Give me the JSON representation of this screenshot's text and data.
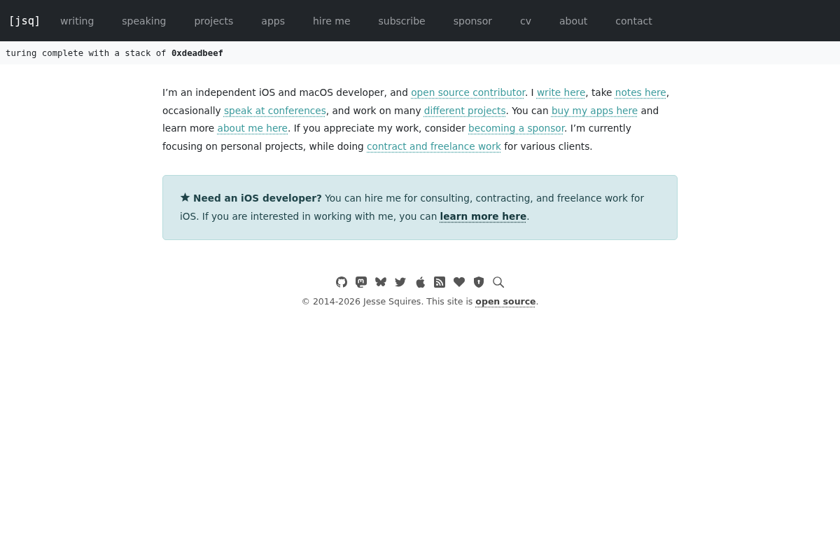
{
  "header": {
    "logo": "[jsq]",
    "nav": [
      {
        "label": "writing"
      },
      {
        "label": "speaking"
      },
      {
        "label": "projects"
      },
      {
        "label": "apps"
      },
      {
        "label": "hire me"
      },
      {
        "label": "subscribe"
      },
      {
        "label": "sponsor"
      },
      {
        "label": "cv"
      },
      {
        "label": "about"
      },
      {
        "label": "contact"
      }
    ]
  },
  "tagline": "turing complete with a stack of **0xdeadbeef**",
  "intro": [
    {
      "kind": "text",
      "text": "I’m an independent iOS and macOS developer, and "
    },
    {
      "kind": "link",
      "text": "open source contributor"
    },
    {
      "kind": "text",
      "text": ". I "
    },
    {
      "kind": "link",
      "text": "write here"
    },
    {
      "kind": "text",
      "text": ", take "
    },
    {
      "kind": "link",
      "text": "notes here"
    },
    {
      "kind": "text",
      "text": ", occasionally "
    },
    {
      "kind": "link",
      "text": "speak at conferences"
    },
    {
      "kind": "text",
      "text": ", and work on many "
    },
    {
      "kind": "link",
      "text": "different projects"
    },
    {
      "kind": "text",
      "text": ". You can "
    },
    {
      "kind": "link",
      "text": "buy my apps here"
    },
    {
      "kind": "text",
      "text": " and learn more "
    },
    {
      "kind": "link",
      "text": "about me here"
    },
    {
      "kind": "text",
      "text": ". If you appreciate my work, consider "
    },
    {
      "kind": "link",
      "text": "becoming a sponsor"
    },
    {
      "kind": "text",
      "text": ". I’m currently focusing on personal projects, while doing "
    },
    {
      "kind": "link",
      "text": "contract and freelance work"
    },
    {
      "kind": "text",
      "text": " for various clients."
    }
  ],
  "callout": [
    {
      "kind": "text",
      "text": "**Need an iOS developer?** You can hire me for consulting, contracting, and freelance work for iOS. If you are interested in working with me, you can "
    },
    {
      "kind": "link",
      "text": "learn more here"
    },
    {
      "kind": "text",
      "text": "."
    }
  ],
  "footer": [
    {
      "kind": "text",
      "text": "© 2014-2026 Jesse Squires. This site is "
    },
    {
      "kind": "link",
      "text": "open source"
    },
    {
      "kind": "text",
      "text": "."
    }
  ]
}
